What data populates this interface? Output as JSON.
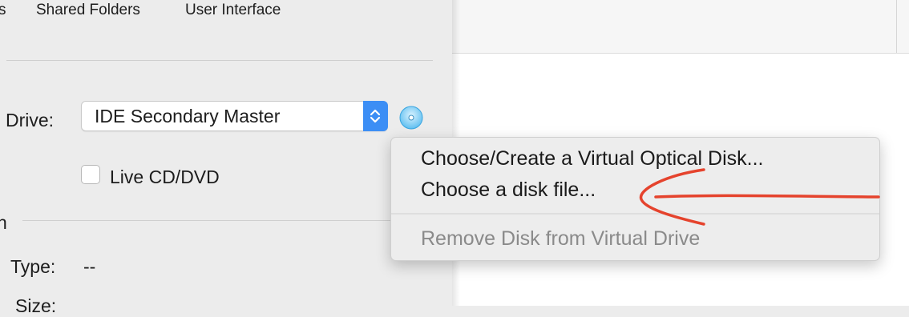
{
  "tabs": {
    "partial_left": "s",
    "shared_folders": "Shared Folders",
    "user_interface": "User Interface"
  },
  "storage": {
    "drive_label": "Drive:",
    "drive_value": "IDE Secondary Master",
    "live_cd_label": "Live CD/DVD",
    "section_partial": "n",
    "type_label": "Type:",
    "type_value": "--",
    "size_label": "Size:"
  },
  "context_menu": {
    "items": [
      {
        "label": "Choose/Create a Virtual Optical Disk...",
        "enabled": true
      },
      {
        "label": "Choose a disk file...",
        "enabled": true
      },
      {
        "label": "Remove Disk from Virtual Drive",
        "enabled": false
      }
    ]
  },
  "colors": {
    "accent": "#3c8ef5",
    "annotation": "#e5432d"
  },
  "icons": {
    "stepper": "chevron-up-down-icon",
    "optical_disk": "optical-disk-icon"
  }
}
